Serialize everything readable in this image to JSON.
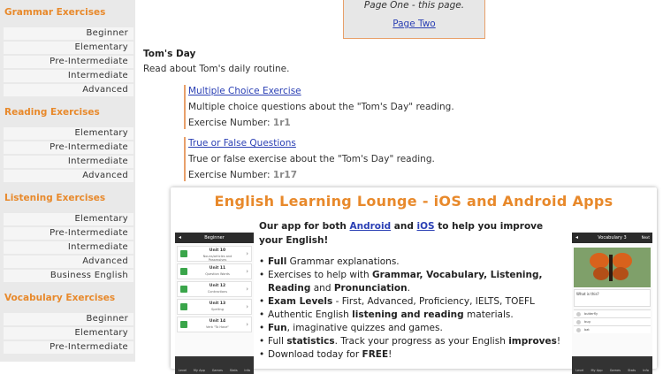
{
  "sidebar": {
    "sections": [
      {
        "title": "Grammar Exercises",
        "items": [
          "Beginner",
          "Elementary",
          "Pre-Intermediate",
          "Intermediate",
          "Advanced"
        ]
      },
      {
        "title": "Reading Exercises",
        "items": [
          "Elementary",
          "Pre-Intermediate",
          "Intermediate",
          "Advanced"
        ]
      },
      {
        "title": "Listening Exercises",
        "items": [
          "Elementary",
          "Pre-Intermediate",
          "Intermediate",
          "Advanced",
          "Business English"
        ]
      },
      {
        "title": "Vocabulary Exercises",
        "items": [
          "Beginner",
          "Elementary",
          "Pre-Intermediate"
        ]
      }
    ]
  },
  "pagination": {
    "page_one": "Page One - this page.",
    "page_two": "Page Two"
  },
  "reading": {
    "title": "Tom's Day",
    "description": "Read about Tom's daily routine."
  },
  "exercises": [
    {
      "link": "Multiple Choice Exercise",
      "description": "Multiple choice questions about the \"Tom's Day\" reading.",
      "number_label": "Exercise Number:",
      "number": "1r1"
    },
    {
      "link": "True or False Questions",
      "description": "True or false exercise about the \"Tom's Day\" reading.",
      "number_label": "Exercise Number:",
      "number": "1r17"
    }
  ],
  "promo": {
    "title": "English Learning Lounge - iOS and Android Apps",
    "intro_prefix": "Our app for both",
    "android": "Android",
    "and": "and",
    "ios": "iOS",
    "intro_suffix": "to help you improve your English!",
    "features": [
      {
        "bold": "Full",
        "rest": "Grammar explanations."
      },
      {
        "pre": "Exercises to help with",
        "bold": "Grammar, Vocabulary, Listening, Reading",
        "mid": "and",
        "bold2": "Pronunciation",
        "post": "."
      },
      {
        "bold": "Exam Levels",
        "rest": "- First, Advanced, Proficiency, IELTS, TOEFL"
      },
      {
        "pre": "Authentic English",
        "bold": "listening and reading",
        "rest": "materials."
      },
      {
        "bold": "Fun",
        "rest": ", imaginative quizzes and games."
      },
      {
        "pre": "Full",
        "bold": "statistics",
        "mid": ". Track your progress as your English",
        "bold2": "improves",
        "post": "!"
      },
      {
        "pre": "Download today for",
        "bold": "FREE",
        "post": "!"
      }
    ],
    "phone_left": {
      "header": "Beginner",
      "units": [
        {
          "title": "Unit 10",
          "sub": "Nouns/articles and Possessives"
        },
        {
          "title": "Unit 11",
          "sub": "Question Words"
        },
        {
          "title": "Unit 12",
          "sub": "Contractions"
        },
        {
          "title": "Unit 13",
          "sub": "Spelling"
        },
        {
          "title": "Unit 14",
          "sub": "Verb \"To Have\""
        }
      ],
      "tabs": [
        "Level",
        "My App",
        "Games",
        "Stats",
        "Info"
      ]
    },
    "phone_right": {
      "header": "Vocabulary 3",
      "next": "Next",
      "question": "What is this?",
      "answers": [
        "butterfly",
        "bug",
        "bat"
      ],
      "tabs": [
        "Level",
        "My App",
        "Games",
        "Stats",
        "Info"
      ]
    }
  }
}
